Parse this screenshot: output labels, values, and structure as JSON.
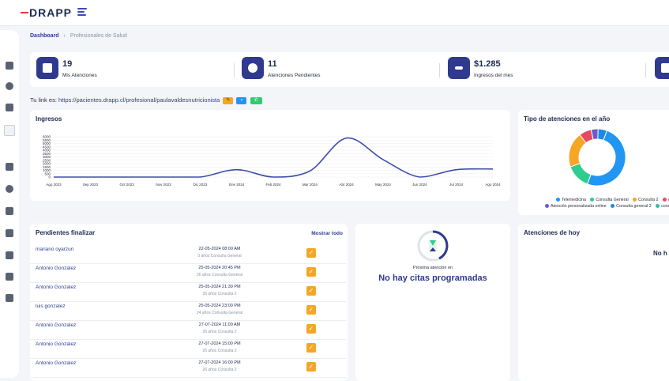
{
  "header": {
    "logo": "DRAPP"
  },
  "breadcrumb": {
    "home": "Dashboard",
    "sep": "›",
    "current": "Profesionales de Salud"
  },
  "stats": [
    {
      "value": "19",
      "label": "Mis Atenciones"
    },
    {
      "value": "11",
      "label": "Atenciones Pendientes"
    },
    {
      "value": "$1.285",
      "label": "Ingresos del mes"
    }
  ],
  "link": {
    "prefix": "Tu link es:",
    "url": "https://pacientes.drapp.cl/profesional/paulavaldesnutricionista"
  },
  "ingresos": {
    "title": "Ingresos",
    "chart_data": {
      "type": "line",
      "title": "Ingresos",
      "categories": [
        "Ago 2023",
        "Sep 2023",
        "Oct 2023",
        "Nov 2023",
        "Dic 2023",
        "Ene 2024",
        "Feb 2024",
        "Mar 2024",
        "Abr 2024",
        "May 2024",
        "Jun 2024",
        "Jul 2024",
        "Ago 2024"
      ],
      "series": [
        {
          "values": [
            0,
            0,
            0,
            0,
            0,
            1100,
            0,
            900,
            5800,
            2600,
            0,
            1100,
            1200
          ]
        }
      ],
      "yticks": [
        "0",
        "500",
        "1000",
        "1500",
        "2000",
        "2500",
        "3000",
        "3500",
        "4000",
        "4500",
        "5000",
        "5500",
        "6000"
      ],
      "ylim": [
        0,
        6000
      ],
      "color": "#3f4fa8"
    }
  },
  "tipo": {
    "title": "Tipo de atenciones en el año",
    "legend": [
      {
        "label": "Telemedicina",
        "color": "#2196f3"
      },
      {
        "label": "Consulta General",
        "color": "#2ecc8f"
      },
      {
        "label": "Consulta 2",
        "color": "#f5a623"
      },
      {
        "label": "con",
        "color": "#e84a5f"
      },
      {
        "label": "Atención personalizada online",
        "color": "#6a5acd"
      },
      {
        "label": "Consulta general 2",
        "color": "#1e88e5"
      },
      {
        "label": "consul",
        "color": "#26c6a0"
      }
    ],
    "slices": [
      0.5,
      0.14,
      0.2,
      0.07,
      0.04,
      0.05
    ]
  },
  "pendientes": {
    "title": "Pendientes finalizar",
    "show_all": "Mostrar todo",
    "rows": [
      {
        "name": "mariano oyarzun",
        "date": "22-05-2024 08:00 AM",
        "sub": "0 años Consulta General"
      },
      {
        "name": "Antonio Gonzalez",
        "date": "25-05-2024 20:45 PM",
        "sub": "26 años Consulta General"
      },
      {
        "name": "Antonio Gonzalez",
        "date": "25-05-2024 21:30 PM",
        "sub": "26 años Consulta 2"
      },
      {
        "name": "luis gonzalez",
        "date": "25-05-2024 23:00 PM",
        "sub": "24 años Consulta General"
      },
      {
        "name": "Antonio Gonzalez",
        "date": "27-07-2024 11:00 AM",
        "sub": "26 años Consulta 2"
      },
      {
        "name": "Antonio Gonzalez",
        "date": "27-07-2024 15:00 PM",
        "sub": "26 años Consulta 2"
      },
      {
        "name": "Antonio Gonzalez",
        "date": "27-07-2024 16:00 PM",
        "sub": "26 años Consulta 2"
      }
    ]
  },
  "proxima": {
    "label": "Próxima atención en",
    "empty": "No hay citas programadas"
  },
  "hoy": {
    "title": "Atenciones de hoy",
    "empty": "No h"
  }
}
